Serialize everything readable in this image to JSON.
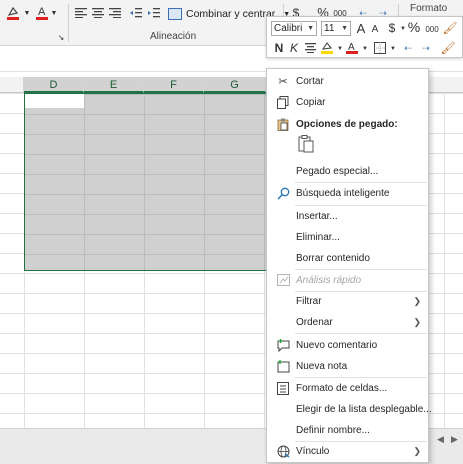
{
  "ribbon": {
    "merge_label": "Combinar y centrar",
    "alignment_group": "Alineación",
    "format_label": "Formato",
    "percent_symbol": "%",
    "thousands_symbol": "000",
    "currency_symbol": "$",
    "icons": [
      "fill-color-icon",
      "font-color-icon",
      "align-left-icon",
      "align-center-icon",
      "align-right-icon",
      "indent-decrease-icon",
      "indent-increase-icon",
      "merge-center-icon",
      "dialog-launcher-icon"
    ]
  },
  "mini_toolbar": {
    "font": "Calibri",
    "size": "11",
    "bold": "N",
    "italic": "K",
    "grow_font": "A",
    "shrink_font": "A",
    "currency": "$",
    "percent": "%",
    "thousands": "000",
    "font_color_glyph": "A",
    "accent_font_color": "#e02020",
    "accent_fill_color": "#ffd800"
  },
  "sheet": {
    "columns": [
      "D",
      "E",
      "F",
      "G"
    ],
    "accent": "#217346"
  },
  "context_menu": {
    "items": [
      {
        "label": "Cortar",
        "icon": "scissors-icon"
      },
      {
        "label": "Copiar",
        "icon": "copy-icon"
      },
      {
        "label": "Opciones de pegado:",
        "icon": "paste-icon"
      },
      {
        "label": "Pegado especial...",
        "icon": ""
      },
      {
        "label": "Búsqueda inteligente",
        "icon": "smart-lookup-icon"
      },
      {
        "label": "Insertar...",
        "icon": ""
      },
      {
        "label": "Eliminar...",
        "icon": ""
      },
      {
        "label": "Borrar contenido",
        "icon": ""
      },
      {
        "label": "Análisis rápido",
        "icon": "quick-analysis-icon"
      },
      {
        "label": "Filtrar",
        "icon": "",
        "submenu": ">"
      },
      {
        "label": "Ordenar",
        "icon": "",
        "submenu": ">"
      },
      {
        "label": "Nuevo comentario",
        "icon": "new-comment-icon"
      },
      {
        "label": "Nueva nota",
        "icon": "new-note-icon"
      },
      {
        "label": "Formato de celdas...",
        "icon": "format-cells-icon"
      },
      {
        "label": "Elegir de la lista desplegable...",
        "icon": ""
      },
      {
        "label": "Definir nombre...",
        "icon": ""
      },
      {
        "label": "Vínculo",
        "icon": "link-icon",
        "submenu": ">"
      }
    ]
  }
}
